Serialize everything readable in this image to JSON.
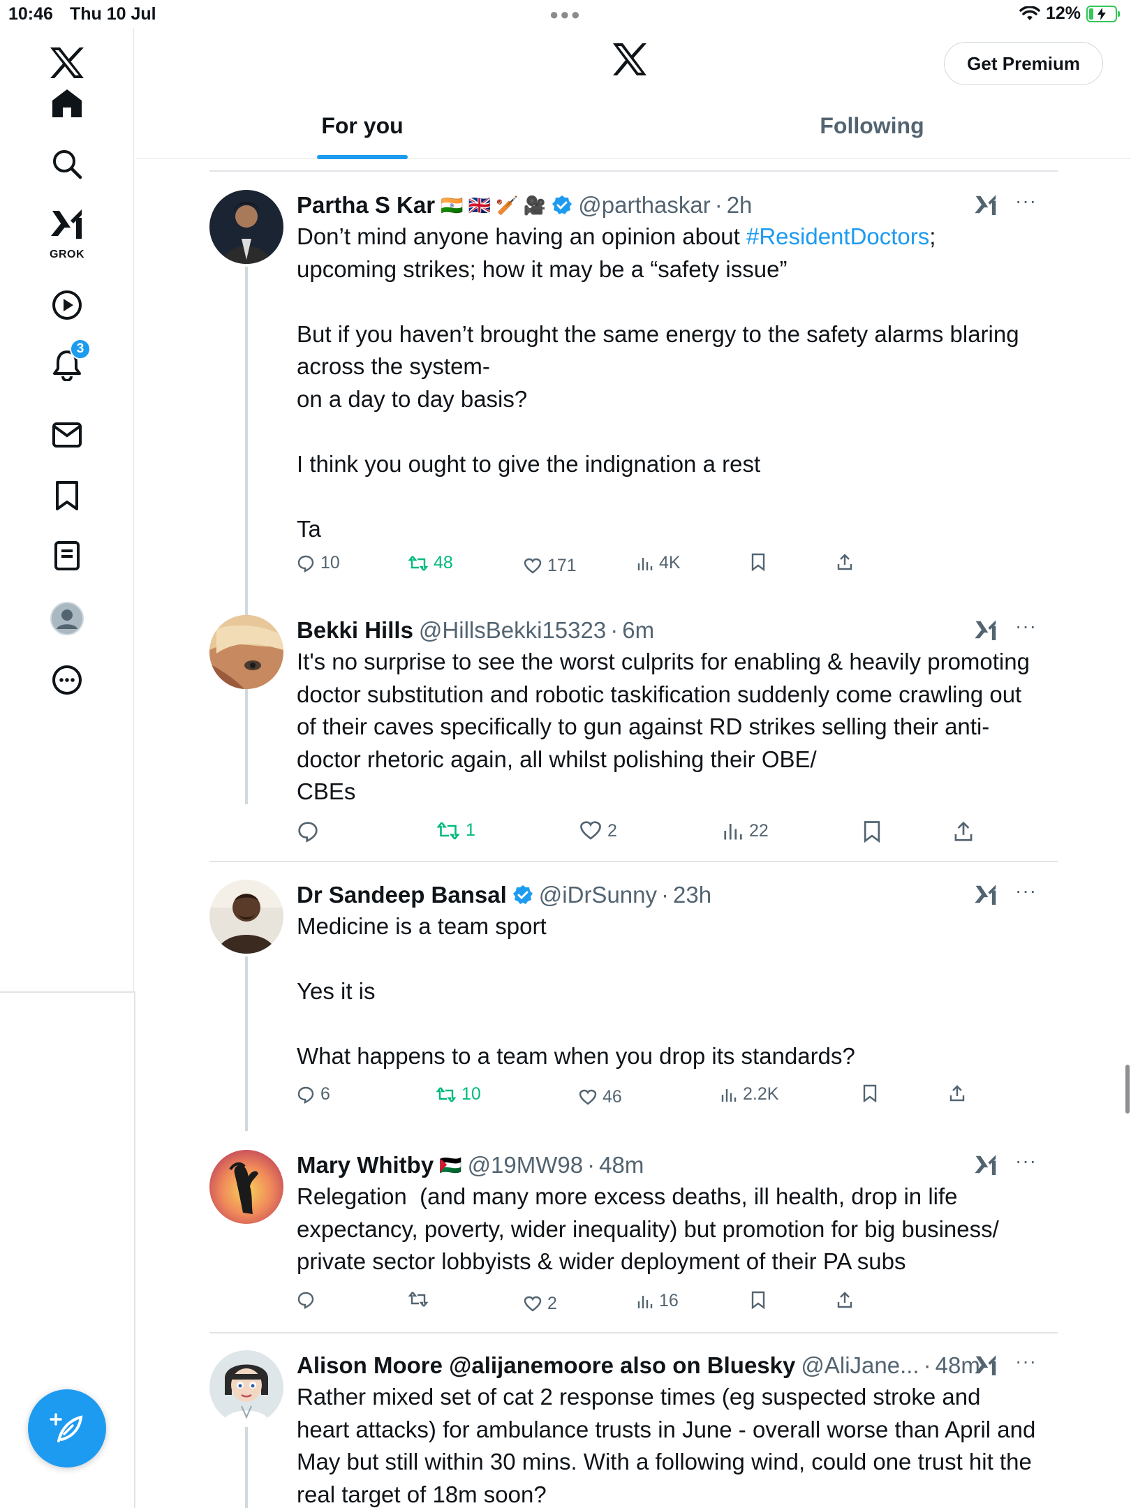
{
  "status_bar": {
    "time": "10:46",
    "date": "Thu 10 Jul",
    "battery": "12%"
  },
  "sidebar": {
    "items": [
      {
        "icon": "x-logo"
      },
      {
        "icon": "home-icon"
      },
      {
        "icon": "search-icon"
      },
      {
        "icon": "grok-icon",
        "label": "GROK"
      },
      {
        "icon": "video-icon"
      },
      {
        "icon": "bell-icon",
        "badge": "3"
      },
      {
        "icon": "mail-icon"
      },
      {
        "icon": "bookmark-icon"
      },
      {
        "icon": "lists-icon"
      },
      {
        "icon": "profile-icon"
      },
      {
        "icon": "more-icon"
      }
    ]
  },
  "header": {
    "premium_label": "Get Premium",
    "tabs": [
      {
        "label": "For you",
        "active": true
      },
      {
        "label": "Following",
        "active": false
      }
    ]
  },
  "colors": {
    "accent": "#1d9bf0",
    "retweet": "#00ba7c",
    "muted": "#536471"
  },
  "tweets": [
    {
      "name": "Partha S Kar",
      "flags": "🇮🇳 🇬🇧 🏏 🎥",
      "verified": true,
      "handle": "@parthaskar",
      "time": "2h",
      "text_before": "Don’t mind anyone having an opinion about ",
      "hashtag": "#ResidentDoctors",
      "text_after": ";\nupcoming strikes; how it may be a “safety issue”\n\nBut if you haven’t brought the same energy to the safety alarms blaring across the system-\non a day to day basis?\n\nI think you ought to give the indignation a rest\n\nTa",
      "replies": "10",
      "retweets": "48",
      "likes": "171",
      "views": "4K"
    },
    {
      "name": "Bekki Hills",
      "handle": "@HillsBekki15323",
      "time": "6m",
      "text": "It's no surprise to see the worst culprits for enabling & heavily promoting doctor substitution and robotic taskification suddenly come crawling out of their caves specifically to gun against RD strikes selling their anti-doctor rhetoric again, all whilst polishing their OBE/\nCBEs",
      "replies": "",
      "retweets": "1",
      "likes": "2",
      "views": "22"
    },
    {
      "name": "Dr Sandeep Bansal",
      "verified": true,
      "handle": "@iDrSunny",
      "time": "23h",
      "text": "Medicine is a team sport\n\nYes it is\n\nWhat happens to a team when you drop its standards?",
      "replies": "6",
      "retweets": "10",
      "likes": "46",
      "views": "2.2K"
    },
    {
      "name": "Mary Whitby",
      "flags": "🇵🇸",
      "handle": "@19MW98",
      "time": "48m",
      "text": "Relegation  (and many more excess deaths, ill health, drop in life expectancy, poverty, wider inequality) but promotion for big business/\nprivate sector lobbyists & wider deployment of their PA subs",
      "replies": "",
      "retweets": "",
      "likes": "2",
      "views": "16"
    },
    {
      "name": "Alison Moore @alijanemoore also on Bluesky",
      "handle": "@AliJane...",
      "time": "48m",
      "text": "Rather mixed set of cat 2 response times (eg suspected stroke and heart attacks) for ambulance trusts in June - overall worse than April and May but still within 30 mins. With a following wind, could one trust hit the real target of 18m soon?"
    }
  ]
}
